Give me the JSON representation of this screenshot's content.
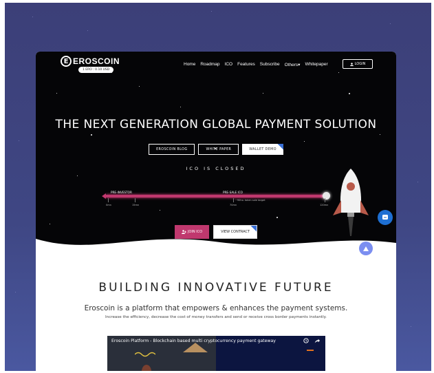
{
  "brand": {
    "logo_letter": "E",
    "name": "EROSCOIN",
    "price": "1 ERO : 0.10 USD"
  },
  "nav": {
    "items": [
      "Home",
      "Roadmap",
      "ICO",
      "Features",
      "Subscribe",
      "Others▾",
      "Whitepaper"
    ],
    "login_label": "LOGIN"
  },
  "hero": {
    "headline": "THE NEXT GENERATION GLOBAL PAYMENT SOLUTION",
    "buttons": {
      "blog": "EROSCOIN BLOG",
      "whitepaper": "WHITE PAPER",
      "wallet": "WALLET DEMO"
    },
    "ico_status": "ICO IS CLOSED",
    "progress": {
      "pre_investor": "PRE-INVESTOR",
      "pre_sale": "PRE-SALE ICO",
      "target_note": "~90ho. token sale target",
      "scale": [
        "0mn",
        "15mn",
        "70mn",
        "120mn"
      ],
      "fill_fraction": 1.0
    },
    "cta": {
      "join": "JOIN ICO",
      "contract": "VIEW CONTRACT"
    }
  },
  "section": {
    "title": "BUILDING INNOVATIVE FUTURE",
    "lead": "Eroscoin is a platform that empowers & enhances the payment systems.",
    "sub": "Increase the efficiency, decrease the cost of money transfers and send or receive cross border payments instantly."
  },
  "video": {
    "title": "Eroscoin Platform - Blockchain based multi cryptocurrency payment gateway"
  },
  "colors": {
    "accent": "#c0386e",
    "chat": "#1e6fd2",
    "scroll_top": "#7b8ef0",
    "ribbon": "#3a70d6"
  }
}
